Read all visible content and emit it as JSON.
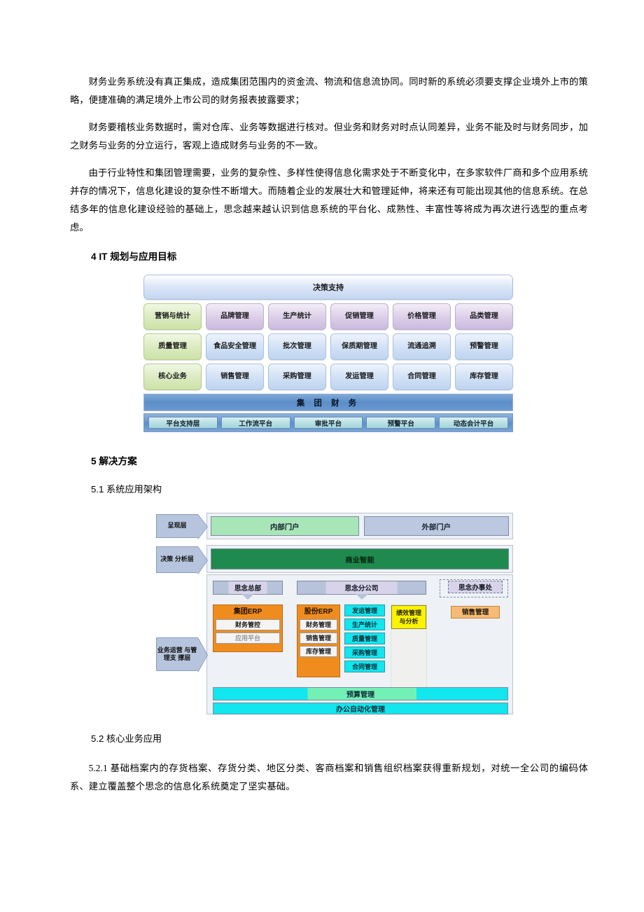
{
  "document": {
    "paragraphs": [
      "财务业务系统没有真正集成，造成集团范围内的资金流、物流和信息流协同。同时新的系统必须要支撑企业境外上市的策略，便捷准确的满足境外上市公司的财务报表披露要求；",
      "财务要稽核业务数据时，需对仓库、业务等数据进行核对。但业务和财务对时点认同差异，业务不能及时与财务同步，加之财务与业务的分立运行，客观上造成财务与业务的不一致。",
      "由于行业特性和集团管理需要，业务的复杂性、多样性使得信息化需求处于不断变化中，在多家软件厂商和多个应用系统并存的情况下，信息化建设的复杂性不断增大。而随着企业的发展壮大和管理延伸，将来还有可能出现其他的信息系统。在总结多年的信息化建设经验的基础上，思念越来越认识到信息系统的平台化、成熟性、丰富性等将成为再次进行选型的重点考虑。"
    ],
    "heading_it_planning": "4 IT 规划与应用目标",
    "heading_solution": "5 解决方案",
    "subheading_architecture": "5.1 系统应用架构",
    "subheading_core_business": "5.2 核心业务应用",
    "paragraph_core_business": "5.2.1 基础档案内的存货档案、存货分类、地区分类、客商档案和销售组织档案获得重新规划，对统一全公司的编码体系、建立覆盖整个思念的信息化系统奠定了坚实基础。"
  },
  "diagram_it_planning": {
    "top_bar": "决策支持",
    "rows": [
      {
        "category": "营销与统计",
        "cells": [
          "品牌管理",
          "生产统计",
          "促销管理",
          "价格管理",
          "品类管理"
        ]
      },
      {
        "category": "质量管理",
        "cells": [
          "食品安全管理",
          "批次管理",
          "保质期管理",
          "流通追溯",
          "预警管理"
        ]
      },
      {
        "category": "核心业务",
        "cells": [
          "销售管理",
          "采购管理",
          "发运管理",
          "合同管理",
          "库存管理"
        ]
      }
    ],
    "finance_bar": "集 团 财 务",
    "platform_cells": [
      "平台支持层",
      "工作流平台",
      "审批平台",
      "预警平台",
      "动态会计平台"
    ],
    "colors": {
      "category": "#cde2a7",
      "row1": "#cbbade",
      "row2_3": "#bdd4f0",
      "finance": "#5b8ec8",
      "platform_cell": "#b6dfe3"
    }
  },
  "diagram_architecture": {
    "layer_labels": [
      "呈现层",
      "决策\n分析层",
      "业务运营\n与管理支\n撑层"
    ],
    "layer1": {
      "label": "呈现层",
      "bars": [
        "内部门户",
        "外部门户"
      ]
    },
    "layer2": {
      "label": "决策 分析层",
      "bars": [
        "商业智能"
      ]
    },
    "layer3": {
      "label": "业务运营 与管理支 撑层",
      "group_headers": [
        "思念总部",
        "思念分公司",
        "思念办事处"
      ],
      "hq_erp": {
        "title": "集团ERP",
        "items": [
          "财务管控",
          "应用平台"
        ]
      },
      "branch_erp": {
        "title": "股份ERP",
        "items": [
          "财务管理",
          "销售管理",
          "库存管理"
        ]
      },
      "branch_modules": [
        "发运管理",
        "生产统计",
        "质量管理",
        "采购管理",
        "合同管理"
      ],
      "performance": "绩效管理与分析",
      "office_sales": "销售管理",
      "bottom_bars": [
        "预算管理",
        "办公自动化管理"
      ]
    },
    "colors": {
      "internal_portal": "#a9e6b7",
      "external_portal": "#bcc8e0",
      "bi": "#1f8a4d",
      "erp": "#f08c1e",
      "module": "#12e6ee",
      "performance": "#fcf303",
      "sales": "#f6bb77",
      "label": "#b6c5dd"
    }
  }
}
